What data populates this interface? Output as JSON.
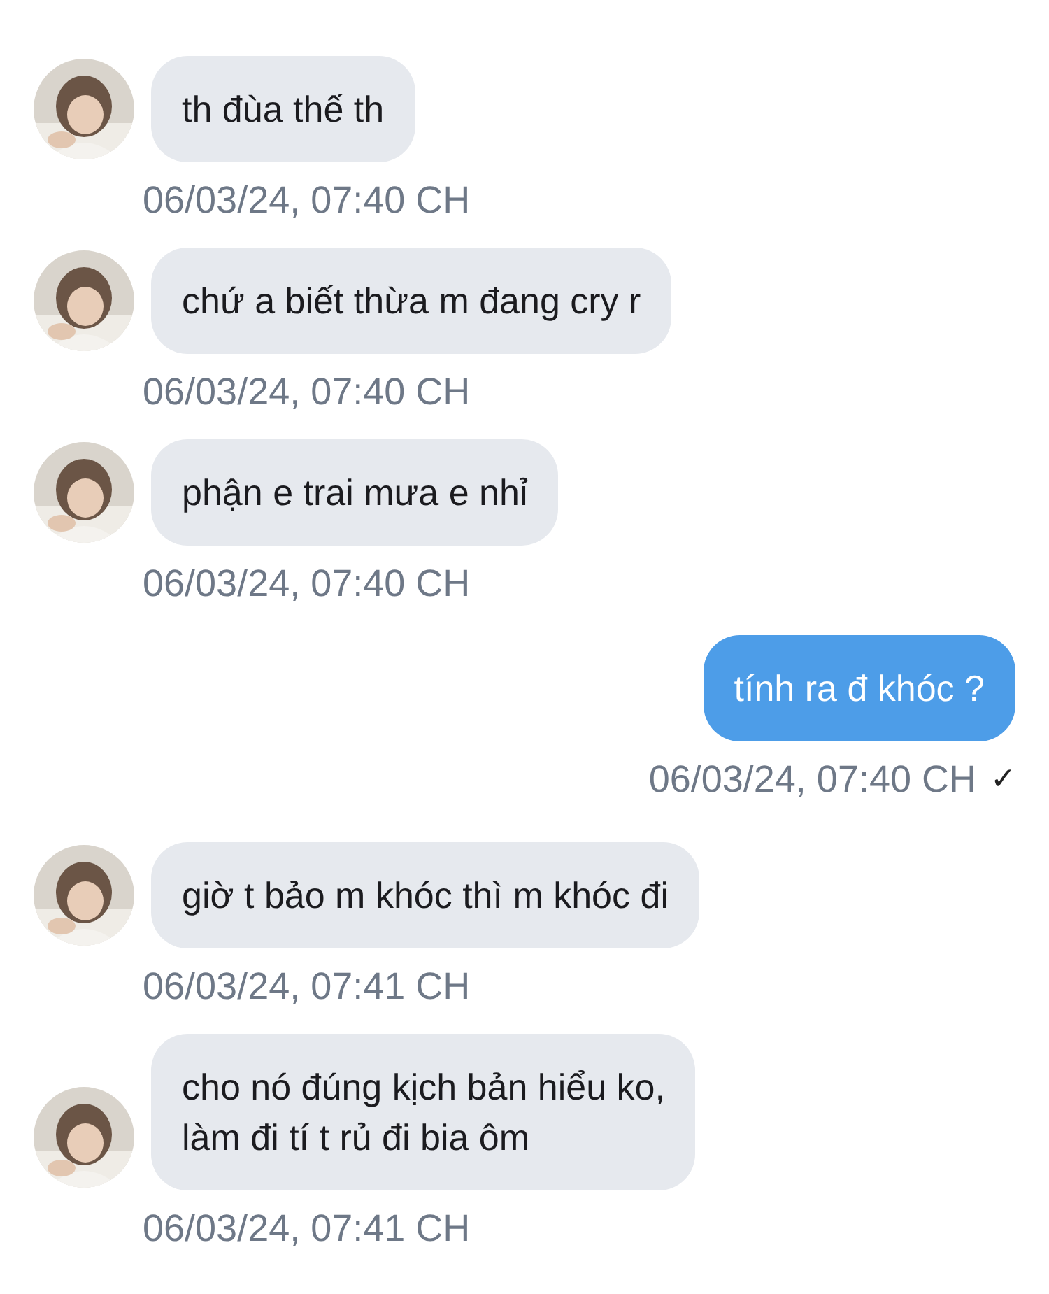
{
  "messages": [
    {
      "kind": "incoming",
      "text": "th đùa thế th",
      "time": "06/03/24, 07:40 CH"
    },
    {
      "kind": "incoming",
      "text": "chứ a biết thừa m đang cry r",
      "time": "06/03/24, 07:40 CH"
    },
    {
      "kind": "incoming",
      "text": "phận e trai mưa e nhỉ",
      "time": "06/03/24, 07:40 CH"
    },
    {
      "kind": "outgoing",
      "text": "tính ra đ khóc ?",
      "time": "06/03/24, 07:40 CH",
      "status_mark": "✓"
    },
    {
      "kind": "incoming",
      "text": "giờ t bảo m khóc thì m khóc đi",
      "time": "06/03/24, 07:41 CH"
    },
    {
      "kind": "incoming",
      "text": "cho nó đúng kịch bản hiểu ko,\nlàm đi tí t rủ đi bia ôm",
      "time": "06/03/24, 07:41 CH"
    }
  ]
}
